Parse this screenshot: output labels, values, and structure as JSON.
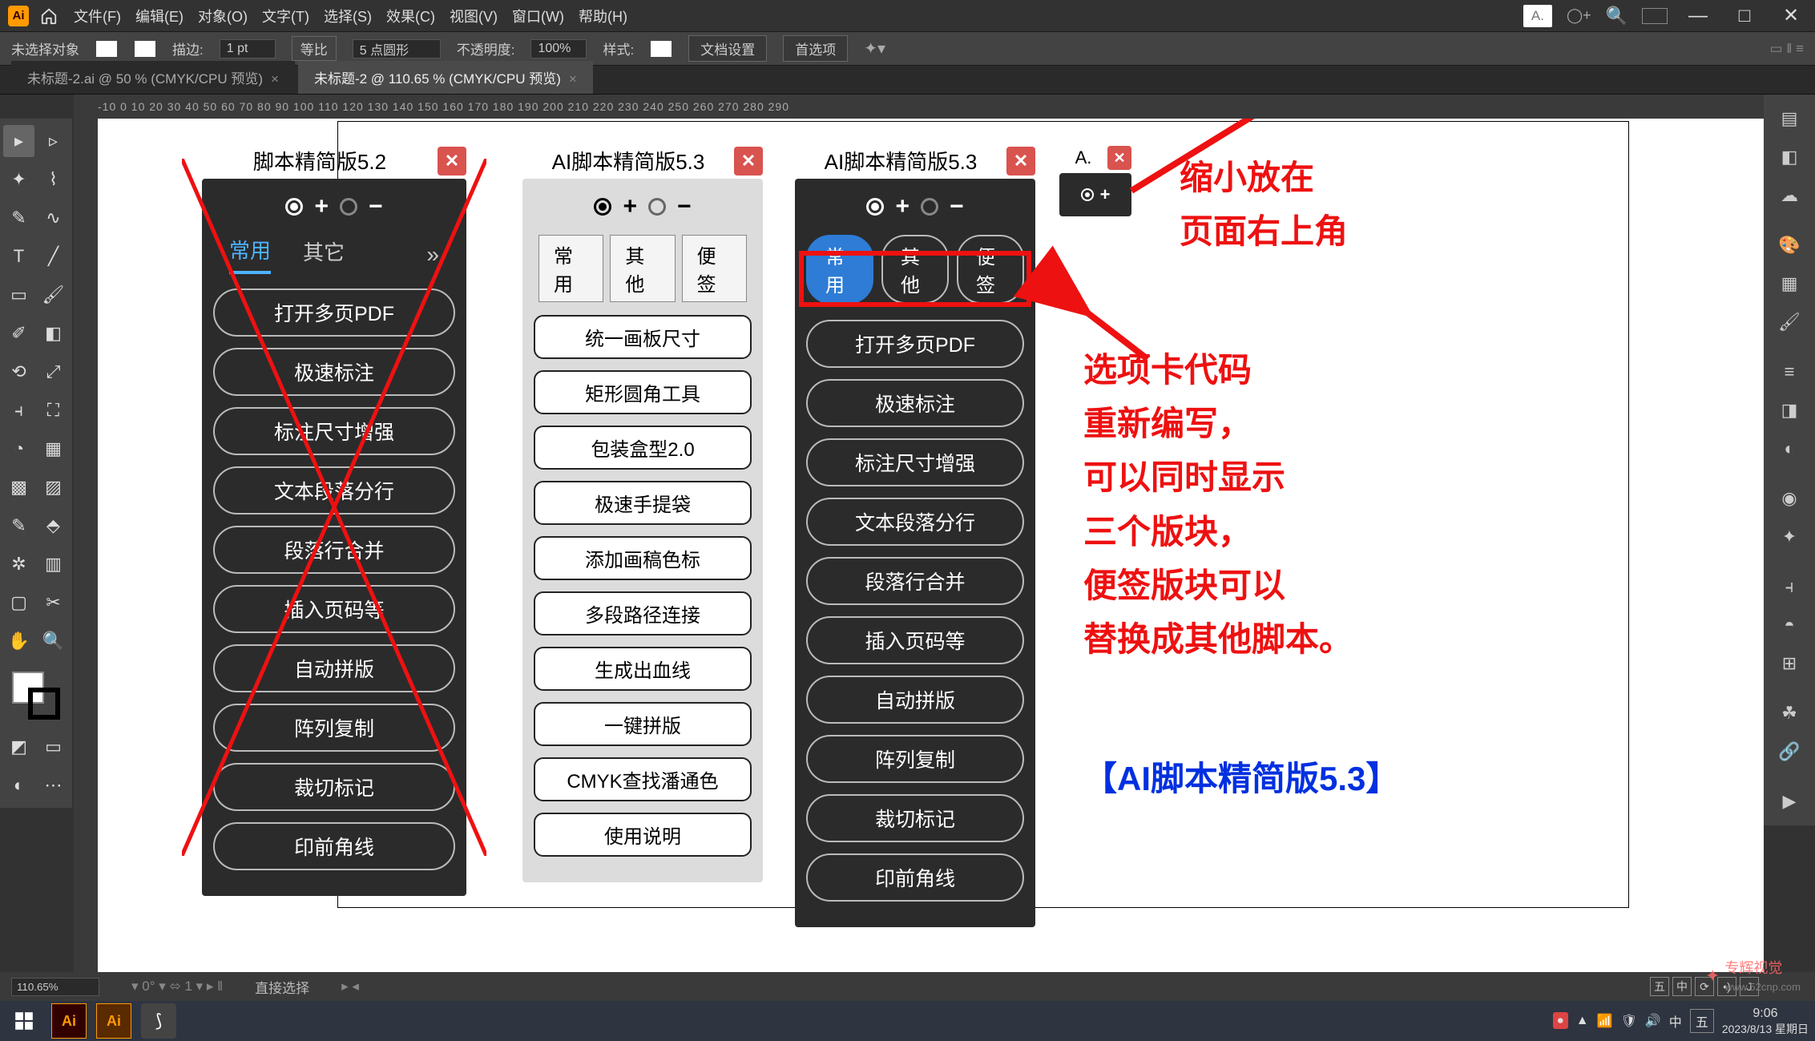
{
  "menu": {
    "items": [
      "文件(F)",
      "编辑(E)",
      "对象(O)",
      "文字(T)",
      "选择(S)",
      "效果(C)",
      "视图(V)",
      "窗口(W)",
      "帮助(H)"
    ],
    "dock_label": "A."
  },
  "optbar": {
    "no_sel": "未选择对象",
    "stroke_lbl": "描边:",
    "stroke_val": "1 pt",
    "uniform": "等比",
    "brush": "5 点圆形",
    "opacity_lbl": "不透明度:",
    "opacity_val": "100%",
    "style_lbl": "样式:",
    "docset": "文档设置",
    "prefs": "首选项"
  },
  "doctabs": [
    {
      "label": "未标题-2.ai @ 50 % (CMYK/CPU 预览)",
      "active": false
    },
    {
      "label": "未标题-2 @ 110.65 % (CMYK/CPU 预览)",
      "active": true
    }
  ],
  "ruler": "-10  0  10  20  30  40  50  60  70  80  90  100  110  120  130  140  150  160  170  180  190  200  210  220  230  240  250  260  270  280  290",
  "panel52": {
    "title": "脚本精简版5.2",
    "tabs": [
      "常用",
      "其它"
    ],
    "buttons": [
      "打开多页PDF",
      "极速标注",
      "标注尺寸增强",
      "文本段落分行",
      "段落行合并",
      "插入页码等",
      "自动拼版",
      "阵列复制",
      "裁切标记",
      "印前角线"
    ]
  },
  "panel53light": {
    "title": "AI脚本精简版5.3",
    "tabs": [
      "常用",
      "其他",
      "便签"
    ],
    "buttons": [
      "统一画板尺寸",
      "矩形圆角工具",
      "包装盒型2.0",
      "极速手提袋",
      "添加画稿色标",
      "多段路径连接",
      "生成出血线",
      "一键拼版",
      "CMYK查找潘通色",
      "使用说明"
    ]
  },
  "panel53dark": {
    "title": "AI脚本精简版5.3",
    "tabs": [
      "常用",
      "其他",
      "便签"
    ],
    "buttons": [
      "打开多页PDF",
      "极速标注",
      "标注尺寸增强",
      "文本段落分行",
      "段落行合并",
      "插入页码等",
      "自动拼版",
      "阵列复制",
      "裁切标记",
      "印前角线"
    ]
  },
  "panelMini": {
    "title": "A."
  },
  "annot1": "缩小放在\n页面右上角",
  "annot2": "选项卡代码\n重新编写，\n可以同时显示\n三个版块，\n便签版块可以\n替换成其他脚本。",
  "annot3": "【AI脚本精简版5.3】",
  "status": {
    "zoom": "110.65%",
    "xy": "",
    "tool": "直接选择"
  },
  "taskbar": {
    "time": "9:06",
    "date": "2023/8/13 星期日",
    "wm": "专辉视觉",
    "wmurl": "www.52cnp.com"
  },
  "ime": [
    "五",
    "中",
    "⟳",
    "•)",
    "J"
  ]
}
